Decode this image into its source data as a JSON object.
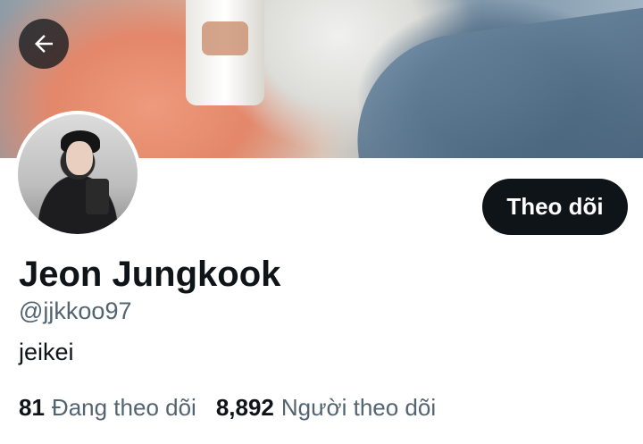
{
  "header": {
    "back_icon": "arrow-left-icon"
  },
  "profile": {
    "display_name": "Jeon Jungkook",
    "handle": "@jjkkoo97",
    "bio": "jeikei",
    "follow_button_label": "Theo dõi"
  },
  "stats": {
    "following_count": "81",
    "following_label": "Đang theo dõi",
    "followers_count": "8,892",
    "followers_label": "Người theo dõi"
  },
  "colors": {
    "primary_text": "#0f1419",
    "secondary_text": "#536471",
    "button_bg": "#0f1419",
    "button_text": "#ffffff"
  }
}
